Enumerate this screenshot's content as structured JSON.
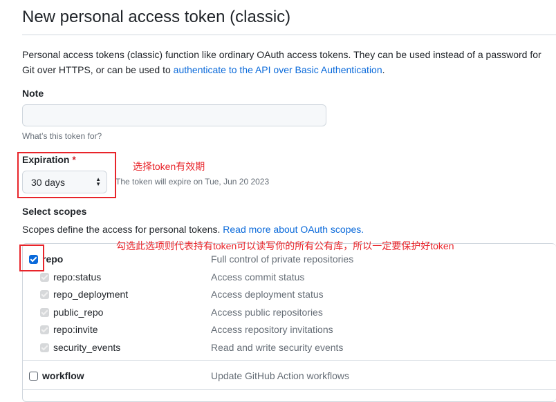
{
  "title": "New personal access token (classic)",
  "description": {
    "text": "Personal access tokens (classic) function like ordinary OAuth access tokens. They can be used instead of a password for Git over HTTPS, or can be used to ",
    "link": "authenticate to the API over Basic Authentication",
    "end": "."
  },
  "note": {
    "label": "Note",
    "value": "",
    "hint": "What’s this token for?"
  },
  "expiration": {
    "label": "Expiration",
    "required": "*",
    "selected": "30 days",
    "hint": "The token will expire on Tue, Jun 20 2023"
  },
  "scopes": {
    "label": "Select scopes",
    "description": "Scopes define the access for personal tokens. ",
    "link": "Read more about OAuth scopes.",
    "items": [
      {
        "name": "repo",
        "desc": "Full control of private repositories",
        "checked": true,
        "bold": true
      },
      {
        "name": "repo:status",
        "desc": "Access commit status",
        "checked": true,
        "sub": true
      },
      {
        "name": "repo_deployment",
        "desc": "Access deployment status",
        "checked": true,
        "sub": true
      },
      {
        "name": "public_repo",
        "desc": "Access public repositories",
        "checked": true,
        "sub": true
      },
      {
        "name": "repo:invite",
        "desc": "Access repository invitations",
        "checked": true,
        "sub": true
      },
      {
        "name": "security_events",
        "desc": "Read and write security events",
        "checked": true,
        "sub": true
      },
      {
        "name": "workflow",
        "desc": "Update GitHub Action workflows",
        "checked": false,
        "bold": true
      }
    ]
  },
  "annotations": {
    "expiration": "选择token有效期",
    "repo": "勾选此选项则代表持有token可以读写你的所有公有库，所以一定要保护好token",
    "color": "#e8242a"
  },
  "accent": "#0969da"
}
